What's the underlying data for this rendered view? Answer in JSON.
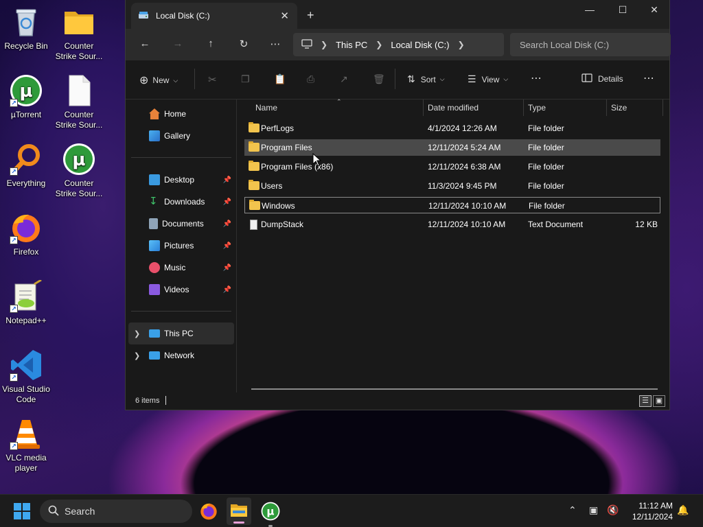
{
  "desktop": {
    "icons": [
      {
        "label": "Recycle Bin",
        "icon": "recycle-bin-icon"
      },
      {
        "label": "Counter Strike Sour...",
        "icon": "folder-icon"
      },
      {
        "label": "µTorrent",
        "icon": "utorrent-icon"
      },
      {
        "label": "Counter Strike Sour...",
        "icon": "document-icon"
      },
      {
        "label": "Everything",
        "icon": "everything-search-icon"
      },
      {
        "label": "Counter Strike Sour...",
        "icon": "utorrent-icon"
      },
      {
        "label": "Firefox",
        "icon": "firefox-icon"
      },
      {
        "label": "Notepad++",
        "icon": "notepadpp-icon"
      },
      {
        "label": "Visual Studio Code",
        "icon": "vscode-icon"
      },
      {
        "label": "VLC media player",
        "icon": "vlc-icon"
      }
    ]
  },
  "window": {
    "tab_title": "Local Disk (C:)",
    "address": {
      "segments": [
        "This PC",
        "Local Disk (C:)"
      ],
      "search_placeholder": "Search Local Disk (C:)"
    },
    "toolbar": {
      "new_label": "New",
      "sort_label": "Sort",
      "view_label": "View",
      "details_label": "Details"
    },
    "sidebar": {
      "top": [
        {
          "label": "Home",
          "icon": "home-icon"
        },
        {
          "label": "Gallery",
          "icon": "gallery-icon"
        }
      ],
      "pinned": [
        {
          "label": "Desktop",
          "icon": "desktop-folder-icon"
        },
        {
          "label": "Downloads",
          "icon": "downloads-icon"
        },
        {
          "label": "Documents",
          "icon": "documents-icon"
        },
        {
          "label": "Pictures",
          "icon": "pictures-icon"
        },
        {
          "label": "Music",
          "icon": "music-icon"
        },
        {
          "label": "Videos",
          "icon": "videos-icon"
        }
      ],
      "tree": [
        {
          "label": "This PC",
          "icon": "this-pc-icon"
        },
        {
          "label": "Network",
          "icon": "network-icon"
        }
      ]
    },
    "columns": [
      "Name",
      "Date modified",
      "Type",
      "Size"
    ],
    "files": [
      {
        "name": "PerfLogs",
        "modified": "4/1/2024 12:26 AM",
        "type": "File folder",
        "size": ""
      },
      {
        "name": "Program Files",
        "modified": "12/11/2024 5:24 AM",
        "type": "File folder",
        "size": ""
      },
      {
        "name": "Program Files (x86)",
        "modified": "12/11/2024 6:38 AM",
        "type": "File folder",
        "size": ""
      },
      {
        "name": "Users",
        "modified": "11/3/2024 9:45 PM",
        "type": "File folder",
        "size": ""
      },
      {
        "name": "Windows",
        "modified": "12/11/2024 10:10 AM",
        "type": "File folder",
        "size": ""
      },
      {
        "name": "DumpStack",
        "modified": "12/11/2024 10:10 AM",
        "type": "Text Document",
        "size": "12 KB"
      }
    ],
    "status": "6 items"
  },
  "taskbar": {
    "search_placeholder": "Search",
    "time": "11:12 AM",
    "date": "12/11/2024"
  }
}
